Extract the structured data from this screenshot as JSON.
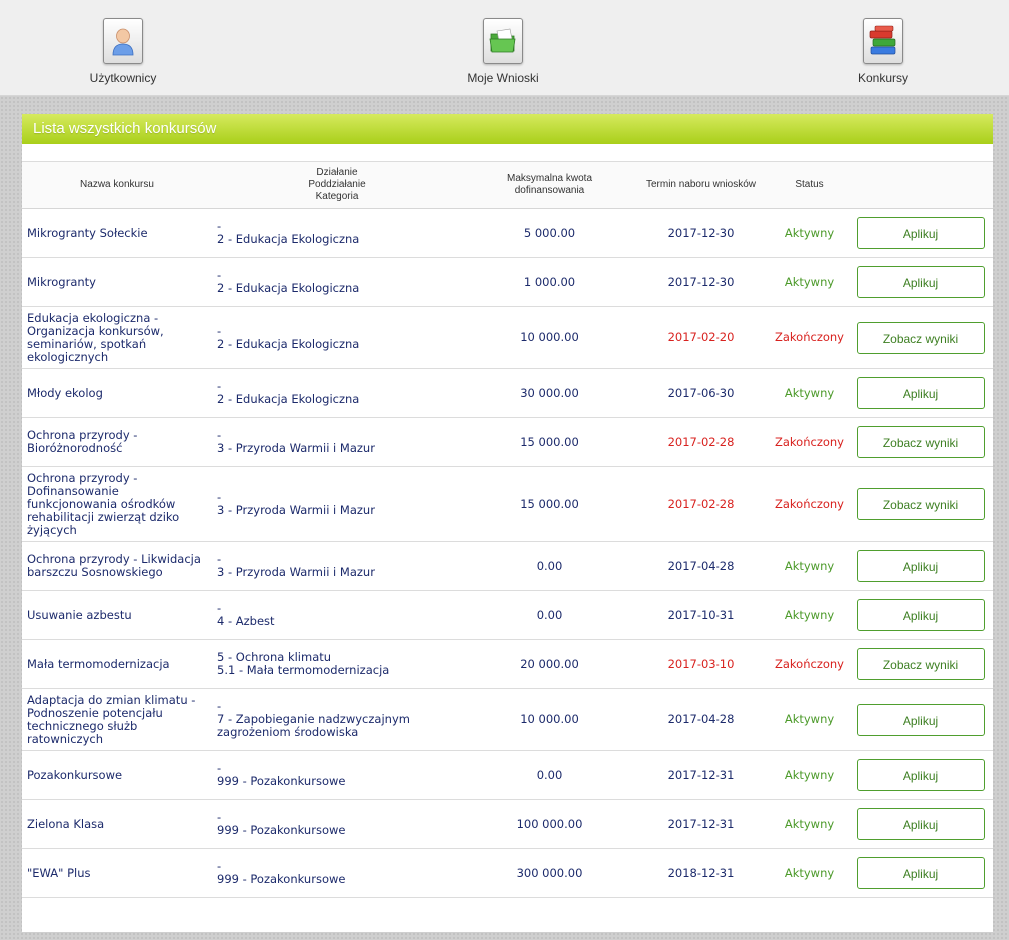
{
  "nav": [
    {
      "label": "Użytkownicy",
      "icon": "user-icon"
    },
    {
      "label": "Moje Wnioski",
      "icon": "folder-icon"
    },
    {
      "label": "Konkursy",
      "icon": "books-icon"
    }
  ],
  "panel": {
    "title": "Lista wszystkich konkursów"
  },
  "table": {
    "headers": {
      "name": "Nazwa konkursu",
      "action_line1": "Działanie",
      "action_line2": "Poddziałanie",
      "action_line3": "Kategoria",
      "amount_line1": "Maksymalna kwota",
      "amount_line2": "dofinansowania",
      "deadline": "Termin naboru wniosków",
      "status": "Status"
    },
    "rows": [
      {
        "name": "Mikrogranty Sołeckie",
        "action1": "-",
        "action2": "2 - Edukacja Ekologiczna",
        "amount": "5 000.00",
        "date": "2017-12-30",
        "status": "Aktywny",
        "state": "active",
        "button": "Aplikuj"
      },
      {
        "name": "Mikrogranty",
        "action1": "-",
        "action2": "2 - Edukacja Ekologiczna",
        "amount": "1 000.00",
        "date": "2017-12-30",
        "status": "Aktywny",
        "state": "active",
        "button": "Aplikuj"
      },
      {
        "name": "Edukacja ekologiczna - Organizacja konkursów, seminariów, spotkań ekologicznych",
        "action1": "-",
        "action2": "2 - Edukacja Ekologiczna",
        "amount": "10 000.00",
        "date": "2017-02-20",
        "status": "Zakończony",
        "state": "ended",
        "button": "Zobacz wyniki"
      },
      {
        "name": "Młody ekolog",
        "action1": "-",
        "action2": "2 - Edukacja Ekologiczna",
        "amount": "30 000.00",
        "date": "2017-06-30",
        "status": "Aktywny",
        "state": "active",
        "button": "Aplikuj"
      },
      {
        "name": "Ochrona przyrody - Bioróżnorodność",
        "action1": "-",
        "action2": "3 - Przyroda Warmii i Mazur",
        "amount": "15 000.00",
        "date": "2017-02-28",
        "status": "Zakończony",
        "state": "ended",
        "button": "Zobacz wyniki"
      },
      {
        "name": "Ochrona przyrody - Dofinansowanie funkcjonowania ośrodków rehabilitacji zwierząt dziko żyjących",
        "action1": "-",
        "action2": "3 - Przyroda Warmii i Mazur",
        "amount": "15 000.00",
        "date": "2017-02-28",
        "status": "Zakończony",
        "state": "ended",
        "button": "Zobacz wyniki"
      },
      {
        "name": "Ochrona przyrody - Likwidacja barszczu Sosnowskiego",
        "action1": "-",
        "action2": "3 - Przyroda Warmii i Mazur",
        "amount": "0.00",
        "date": "2017-04-28",
        "status": "Aktywny",
        "state": "active",
        "button": "Aplikuj"
      },
      {
        "name": "Usuwanie azbestu",
        "action1": "-",
        "action2": "4 - Azbest",
        "amount": "0.00",
        "date": "2017-10-31",
        "status": "Aktywny",
        "state": "active",
        "button": "Aplikuj"
      },
      {
        "name": "Mała termomodernizacja",
        "action1": "5 - Ochrona klimatu",
        "action2": "5.1 - Mała termomodernizacja",
        "amount": "20 000.00",
        "date": "2017-03-10",
        "status": "Zakończony",
        "state": "ended",
        "button": "Zobacz wyniki"
      },
      {
        "name": "Adaptacja do zmian klimatu - Podnoszenie potencjału technicznego służb ratowniczych",
        "action1": "-",
        "action2": "7 - Zapobieganie nadzwyczajnym zagrożeniom środowiska",
        "amount": "10 000.00",
        "date": "2017-04-28",
        "status": "Aktywny",
        "state": "active",
        "button": "Aplikuj"
      },
      {
        "name": "Pozakonkursowe",
        "action1": "-",
        "action2": "999 - Pozakonkursowe",
        "amount": "0.00",
        "date": "2017-12-31",
        "status": "Aktywny",
        "state": "active",
        "button": "Aplikuj"
      },
      {
        "name": "Zielona Klasa",
        "action1": "-",
        "action2": "999 - Pozakonkursowe",
        "amount": "100 000.00",
        "date": "2017-12-31",
        "status": "Aktywny",
        "state": "active",
        "button": "Aplikuj"
      },
      {
        "name": "\"EWA\" Plus",
        "action1": "-",
        "action2": "999 - Pozakonkursowe",
        "amount": "300 000.00",
        "date": "2018-12-31",
        "status": "Aktywny",
        "state": "active",
        "button": "Aplikuj"
      }
    ]
  }
}
